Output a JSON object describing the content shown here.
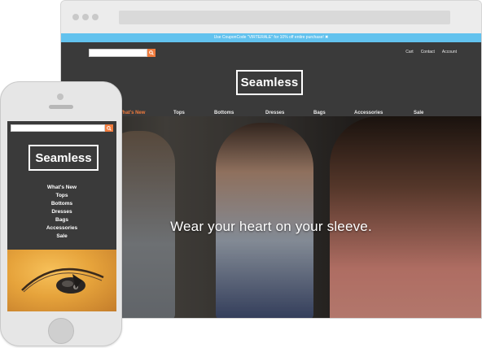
{
  "desktop": {
    "promo_text": "Use CouponCode \"VIRTERALE\" for 10% off entire purchase! ✖",
    "top_links": [
      "Cart",
      "Contact",
      "Account"
    ],
    "logo": "Seamless",
    "categories": [
      "What's New",
      "Tops",
      "Bottoms",
      "Dresses",
      "Bags",
      "Accessories",
      "Sale"
    ],
    "active_category": "What's New",
    "hero_tagline": "Wear your heart on your sleeve."
  },
  "mobile": {
    "logo": "Seamless",
    "menu": [
      "What's New",
      "Tops",
      "Bottoms",
      "Dresses",
      "Bags",
      "Accessories",
      "Sale"
    ]
  },
  "search": {
    "placeholder": ""
  },
  "colors": {
    "accent": "#f07b3d",
    "promo_bar": "#62c2ee",
    "header_bg": "#3a3a3a",
    "text_light": "#ffffff"
  },
  "icons": {
    "search": "search-icon",
    "close": "close-icon"
  }
}
